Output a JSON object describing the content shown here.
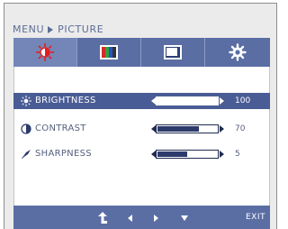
{
  "menu": {
    "root": "MENU",
    "section": "PICTURE"
  },
  "tabs": [
    {
      "icon": "color-temperature-icon",
      "active": true
    },
    {
      "icon": "color-bars-icon",
      "active": false
    },
    {
      "icon": "display-screen-icon",
      "active": false
    },
    {
      "icon": "setup-gear-icon",
      "active": false
    }
  ],
  "settings": [
    {
      "label": "BRIGHTNESS",
      "value": "100",
      "level": 1.0,
      "selected": true,
      "icon": "sun-icon"
    },
    {
      "label": "CONTRAST",
      "value": "70",
      "level": 0.7,
      "selected": false,
      "icon": "contrast-icon"
    },
    {
      "label": "SHARPNESS",
      "value": "5",
      "level": 0.5,
      "selected": false,
      "icon": "sharpness-icon"
    }
  ],
  "footer": {
    "exit_label": "EXIT",
    "buttons": [
      "return-icon",
      "left-arrow-icon",
      "right-arrow-icon",
      "down-arrow-icon"
    ]
  },
  "colors": {
    "accent": "#5a6ea4",
    "selected_row": "#4a5c95",
    "text": "#55617e"
  }
}
